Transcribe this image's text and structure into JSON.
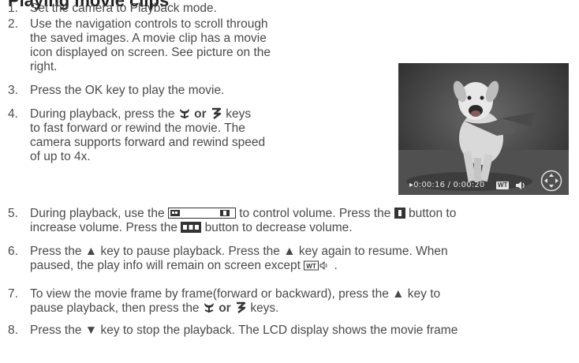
{
  "heading": "Playing movie clips",
  "steps": [
    {
      "num": "1.",
      "lines": [
        "Set the camera to Playback mode."
      ]
    },
    {
      "num": "2.",
      "lines": [
        "Use the navigation controls to scroll through",
        "the saved images. A movie clip has a movie",
        "icon displayed on screen. See picture on the",
        "right."
      ]
    },
    {
      "num": "3.",
      "lines": [
        "Press the OK key to play the movie."
      ]
    },
    {
      "num": "4.",
      "line1_pre": "During playback, press the",
      "line1_or": "or",
      "line1_post": "keys",
      "lines_rest": [
        "to fast forward or rewind the movie. The",
        "camera supports forward and rewind speed",
        "of up to 4x."
      ]
    },
    {
      "num": "5.",
      "line1_pre": "During playback, use the",
      "line1_mid": "to control volume. Press the",
      "line1_post": "button to",
      "line2_pre": "increase volume. Press the",
      "line2_post": "button to decrease volume."
    },
    {
      "num": "6.",
      "line1_pre": "Press the",
      "line1_mid": "key to pause playback. Press the",
      "line1_post": "key again to resume. When",
      "line2_pre": "paused, the play info will remain on screen except",
      "line2_post": "."
    },
    {
      "num": "7.",
      "line1": "To view the movie frame by frame(forward or backward), press the",
      "line1_post": "key to",
      "line2_pre": "pause playback, then press the",
      "line2_or": "or",
      "line2_post": "keys."
    },
    {
      "num": "8.",
      "line1_pre": "Press the",
      "line1_post": "key to stop the playback. The LCD display shows the movie frame"
    }
  ],
  "photo": {
    "timecode": "▸0:00:16 / 0:00:20",
    "wt_label": "WT"
  },
  "icons": [
    "tulip-icon",
    "flower-icon",
    "zoom-bar-icon",
    "tele-icon",
    "wide-icon",
    "up-triangle-icon",
    "down-triangle-icon",
    "speaker-icon",
    "nav-dial-icon"
  ]
}
